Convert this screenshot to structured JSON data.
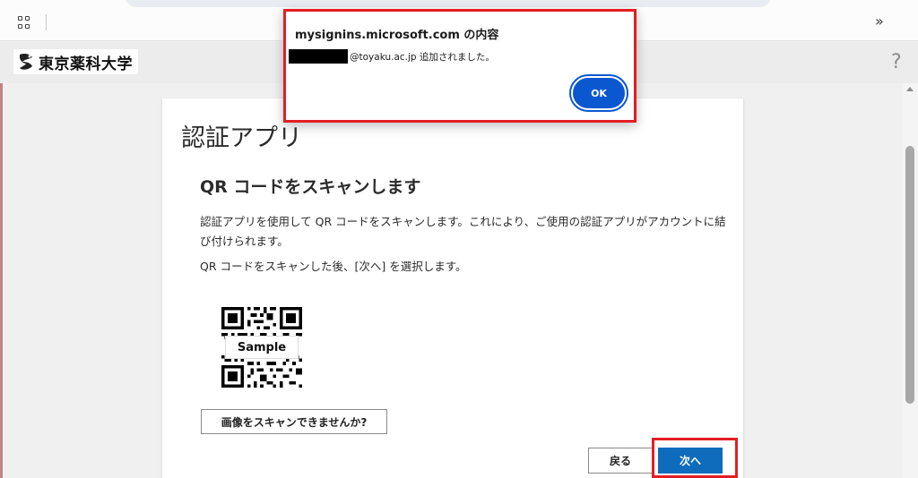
{
  "browser": {
    "more_icon": "chevron-double-right-icon"
  },
  "header": {
    "logo_text": "東京薬科大学",
    "help_text": "?"
  },
  "card": {
    "title": "認証アプリ",
    "subtitle": "QR コードをスキャンします",
    "description": "認証アプリを使用して QR コードをスキャンします。これにより、ご使用の認証アプリがアカウントに結び付けられます。",
    "instruction": "QR コードをスキャンした後、[次へ] を選択します。",
    "qr_label": "Sample",
    "cant_scan_label": "画像をスキャンできませんか?",
    "back_label": "戻る",
    "next_label": "次へ"
  },
  "dialog": {
    "title": "mysignins.microsoft.com の内容",
    "message": "@toyaku.ac.jp 追加されました。",
    "ok_label": "OK"
  },
  "colors": {
    "primary": "#0f6cbd",
    "dialog_primary": "#0b57d0",
    "highlight": "#e31e24"
  }
}
